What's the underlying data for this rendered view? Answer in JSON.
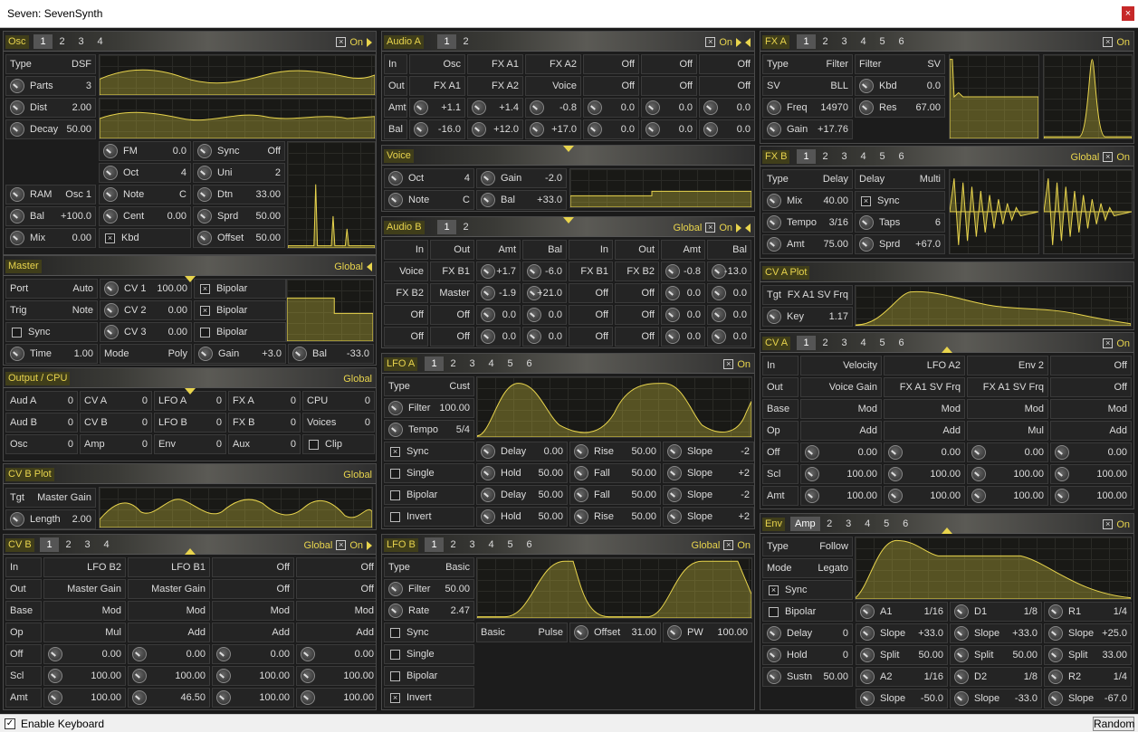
{
  "window": {
    "title": "Seven: SevenSynth",
    "close": "×"
  },
  "colors": {
    "accent": "#e8d44d",
    "bg": "#1c1c1c"
  },
  "statusbar": {
    "enable_keyboard": "Enable Keyboard",
    "checked": "✓",
    "random": "Random"
  },
  "h": {
    "osc": {
      "title": "Osc",
      "tabs": [
        "1",
        "2",
        "3",
        "4"
      ],
      "on": "On"
    },
    "master": {
      "title": "Master",
      "right": "Global"
    },
    "output": {
      "title": "Output / CPU",
      "right": "Global"
    },
    "cvbplot": {
      "title": "CV B Plot",
      "right": "Global"
    },
    "cvb": {
      "title": "CV B",
      "tabs": [
        "1",
        "2",
        "3",
        "4"
      ],
      "right": "Global",
      "on": "On"
    },
    "audioa": {
      "title": "Audio A",
      "tabs": [
        "1",
        "2"
      ],
      "on": "On"
    },
    "voice": {
      "title": "Voice"
    },
    "audiob": {
      "title": "Audio B",
      "tabs": [
        "1",
        "2"
      ],
      "right": "Global",
      "on": "On"
    },
    "lfoa": {
      "title": "LFO A",
      "tabs": [
        "1",
        "2",
        "3",
        "4",
        "5",
        "6"
      ],
      "on": "On"
    },
    "lfob": {
      "title": "LFO B",
      "tabs": [
        "1",
        "2",
        "3",
        "4",
        "5",
        "6"
      ],
      "right": "Global",
      "on": "On"
    },
    "fxa": {
      "title": "FX A",
      "tabs": [
        "1",
        "2",
        "3",
        "4",
        "5",
        "6"
      ],
      "on": "On"
    },
    "fxb": {
      "title": "FX B",
      "tabs": [
        "1",
        "2",
        "3",
        "4",
        "5",
        "6"
      ],
      "right": "Global",
      "on": "On"
    },
    "cvaplot": {
      "title": "CV A Plot"
    },
    "cva": {
      "title": "CV A",
      "tabs": [
        "1",
        "2",
        "3",
        "4",
        "5",
        "6"
      ],
      "on": "On"
    },
    "env": {
      "title": "Env",
      "tabs": [
        "Amp",
        "2",
        "3",
        "4",
        "5",
        "6"
      ],
      "on": "On"
    }
  },
  "cells": {
    "osc": [
      {
        "l": "Type",
        "v": "DSF"
      },
      {
        "l": "Parts",
        "v": "3",
        "k": 1
      },
      {
        "l": "Dist",
        "v": "2.00",
        "k": 1
      },
      {
        "l": "Decay",
        "v": "50.00",
        "k": 1
      },
      {
        "l": "FM",
        "v": "0.0",
        "k": 1
      },
      {
        "l": "Sync",
        "v": "Off",
        "k": 1
      },
      {
        "l": "Oct",
        "v": "4",
        "k": 1
      },
      {
        "l": "Uni",
        "v": "2",
        "k": 1
      },
      {
        "l": "RAM",
        "v": "Osc 1",
        "k": 1
      },
      {
        "l": "Note",
        "v": "C",
        "k": 1
      },
      {
        "l": "Dtn",
        "v": "33.00",
        "k": 1
      },
      {
        "l": "Bal",
        "v": "+100.0",
        "k": 1
      },
      {
        "l": "Cent",
        "v": "0.00",
        "k": 1
      },
      {
        "l": "Sprd",
        "v": "50.00",
        "k": 1
      },
      {
        "l": "Mix",
        "v": "0.00",
        "k": 1
      },
      {
        "l": "Kbd",
        "v": "",
        "c": "x"
      },
      {
        "l": "Offset",
        "v": "50.00",
        "k": 1
      }
    ],
    "master": [
      {
        "l": "Port",
        "v": "Auto"
      },
      {
        "l": "CV 1",
        "v": "100.00",
        "k": 1
      },
      {
        "l": "Bipolar",
        "v": "",
        "c": "x"
      },
      {
        "l": "Trig",
        "v": "Note"
      },
      {
        "l": "CV 2",
        "v": "0.00",
        "k": 1
      },
      {
        "l": "Bipolar",
        "v": "",
        "c": "x"
      },
      {
        "l": "Sync",
        "v": "",
        "c": "o"
      },
      {
        "l": "CV 3",
        "v": "0.00",
        "k": 1
      },
      {
        "l": "Bipolar",
        "v": "",
        "c": "o"
      },
      {
        "l": "Time",
        "v": "1.00",
        "k": 1
      },
      {
        "l": "Mode",
        "v": "Poly"
      },
      {
        "l": "Gain",
        "v": "+3.0",
        "k": 1
      },
      {
        "l": "Bal",
        "v": "-33.0",
        "k": 1
      }
    ],
    "output": [
      {
        "l": "Aud A",
        "v": "0"
      },
      {
        "l": "CV A",
        "v": "0"
      },
      {
        "l": "LFO A",
        "v": "0"
      },
      {
        "l": "FX A",
        "v": "0"
      },
      {
        "l": "CPU",
        "v": "0"
      },
      {
        "l": "Aud B",
        "v": "0"
      },
      {
        "l": "CV B",
        "v": "0"
      },
      {
        "l": "LFO B",
        "v": "0"
      },
      {
        "l": "FX B",
        "v": "0"
      },
      {
        "l": "Voices",
        "v": "0"
      },
      {
        "l": "Osc",
        "v": "0"
      },
      {
        "l": "Amp",
        "v": "0"
      },
      {
        "l": "Env",
        "v": "0"
      },
      {
        "l": "Aux",
        "v": "0"
      },
      {
        "l": "Clip",
        "v": "",
        "c": "r"
      }
    ],
    "cvbplot": [
      {
        "l": "Tgt",
        "v": "Master Gain"
      },
      {
        "l": "Length",
        "v": "2.00",
        "k": 1
      }
    ],
    "cvb": [
      {
        "l": "In",
        "v": ""
      },
      {
        "l": "",
        "v": "LFO B2"
      },
      {
        "l": "",
        "v": "LFO B1"
      },
      {
        "l": "",
        "v": "Off"
      },
      {
        "l": "",
        "v": "Off"
      },
      {
        "l": "Out",
        "v": ""
      },
      {
        "l": "",
        "v": "Master Gain"
      },
      {
        "l": "",
        "v": "Master Gain"
      },
      {
        "l": "",
        "v": "Off"
      },
      {
        "l": "",
        "v": "Off"
      },
      {
        "l": "Base",
        "v": ""
      },
      {
        "l": "",
        "v": "Mod"
      },
      {
        "l": "",
        "v": "Mod"
      },
      {
        "l": "",
        "v": "Mod"
      },
      {
        "l": "",
        "v": "Mod"
      },
      {
        "l": "Op",
        "v": ""
      },
      {
        "l": "",
        "v": "Mul"
      },
      {
        "l": "",
        "v": "Add"
      },
      {
        "l": "",
        "v": "Add"
      },
      {
        "l": "",
        "v": "Add"
      },
      {
        "l": "Off",
        "v": ""
      },
      {
        "l": "",
        "v": "0.00",
        "k": 1
      },
      {
        "l": "",
        "v": "0.00",
        "k": 1
      },
      {
        "l": "",
        "v": "0.00",
        "k": 1
      },
      {
        "l": "",
        "v": "0.00",
        "k": 1
      },
      {
        "l": "Scl",
        "v": ""
      },
      {
        "l": "",
        "v": "100.00",
        "k": 1
      },
      {
        "l": "",
        "v": "100.00",
        "k": 1
      },
      {
        "l": "",
        "v": "100.00",
        "k": 1
      },
      {
        "l": "",
        "v": "100.00",
        "k": 1
      },
      {
        "l": "Amt",
        "v": ""
      },
      {
        "l": "",
        "v": "100.00",
        "k": 1
      },
      {
        "l": "",
        "v": "46.50",
        "k": 1
      },
      {
        "l": "",
        "v": "100.00",
        "k": 1
      },
      {
        "l": "",
        "v": "100.00",
        "k": 1
      }
    ],
    "audioa": [
      {
        "l": "In",
        "v": ""
      },
      {
        "l": "",
        "v": "Osc"
      },
      {
        "l": "",
        "v": "FX A1"
      },
      {
        "l": "",
        "v": "FX A2"
      },
      {
        "l": "",
        "v": "Off"
      },
      {
        "l": "",
        "v": "Off"
      },
      {
        "l": "",
        "v": "Off"
      },
      {
        "l": "Out",
        "v": ""
      },
      {
        "l": "",
        "v": "FX A1"
      },
      {
        "l": "",
        "v": "FX A2"
      },
      {
        "l": "",
        "v": "Voice"
      },
      {
        "l": "",
        "v": "Off"
      },
      {
        "l": "",
        "v": "Off"
      },
      {
        "l": "",
        "v": "Off"
      },
      {
        "l": "Amt",
        "v": ""
      },
      {
        "l": "",
        "v": "+1.1",
        "k": 1
      },
      {
        "l": "",
        "v": "+1.4",
        "k": 1
      },
      {
        "l": "",
        "v": "-0.8",
        "k": 1
      },
      {
        "l": "",
        "v": "0.0",
        "k": 1
      },
      {
        "l": "",
        "v": "0.0",
        "k": 1
      },
      {
        "l": "",
        "v": "0.0",
        "k": 1
      },
      {
        "l": "Bal",
        "v": ""
      },
      {
        "l": "",
        "v": "-16.0",
        "k": 1
      },
      {
        "l": "",
        "v": "+12.0",
        "k": 1
      },
      {
        "l": "",
        "v": "+17.0",
        "k": 1
      },
      {
        "l": "",
        "v": "0.0",
        "k": 1
      },
      {
        "l": "",
        "v": "0.0",
        "k": 1
      },
      {
        "l": "",
        "v": "0.0",
        "k": 1
      }
    ],
    "voice": [
      {
        "l": "Oct",
        "v": "4",
        "k": 1
      },
      {
        "l": "Gain",
        "v": "-2.0",
        "k": 1
      },
      {
        "l": "Note",
        "v": "C",
        "k": 1
      },
      {
        "l": "Bal",
        "v": "+33.0",
        "k": 1
      }
    ],
    "audiobh": [
      {
        "l": "",
        "v": "In"
      },
      {
        "l": "",
        "v": "Out"
      },
      {
        "l": "",
        "v": "Amt"
      },
      {
        "l": "",
        "v": "Bal"
      },
      {
        "l": "",
        "v": "In"
      },
      {
        "l": "",
        "v": "Out"
      },
      {
        "l": "",
        "v": "Amt"
      },
      {
        "l": "",
        "v": "Bal"
      }
    ],
    "audiob": [
      {
        "l": "",
        "v": "Voice"
      },
      {
        "l": "",
        "v": "FX B1"
      },
      {
        "l": "",
        "v": "+1.7",
        "k": 1
      },
      {
        "l": "",
        "v": "-6.0",
        "k": 1
      },
      {
        "l": "",
        "v": "FX B1"
      },
      {
        "l": "",
        "v": "FX B2"
      },
      {
        "l": "",
        "v": "-0.8",
        "k": 1
      },
      {
        "l": "",
        "v": "-13.0",
        "k": 1
      },
      {
        "l": "",
        "v": "FX B2"
      },
      {
        "l": "",
        "v": "Master"
      },
      {
        "l": "",
        "v": "-1.9",
        "k": 1
      },
      {
        "l": "",
        "v": "+21.0",
        "k": 1
      },
      {
        "l": "",
        "v": "Off"
      },
      {
        "l": "",
        "v": "Off"
      },
      {
        "l": "",
        "v": "0.0",
        "k": 1
      },
      {
        "l": "",
        "v": "0.0",
        "k": 1
      },
      {
        "l": "",
        "v": "Off"
      },
      {
        "l": "",
        "v": "Off"
      },
      {
        "l": "",
        "v": "0.0",
        "k": 1
      },
      {
        "l": "",
        "v": "0.0",
        "k": 1
      },
      {
        "l": "",
        "v": "Off"
      },
      {
        "l": "",
        "v": "Off"
      },
      {
        "l": "",
        "v": "0.0",
        "k": 1
      },
      {
        "l": "",
        "v": "0.0",
        "k": 1
      },
      {
        "l": "",
        "v": "Off"
      },
      {
        "l": "",
        "v": "Off"
      },
      {
        "l": "",
        "v": "0.0",
        "k": 1
      },
      {
        "l": "",
        "v": "0.0",
        "k": 1
      },
      {
        "l": "",
        "v": "Off"
      },
      {
        "l": "",
        "v": "Off"
      },
      {
        "l": "",
        "v": "0.0",
        "k": 1
      },
      {
        "l": "",
        "v": "0.0",
        "k": 1
      }
    ],
    "lfoa": [
      {
        "l": "Type",
        "v": "Cust"
      },
      {
        "l": "Filter",
        "v": "100.00",
        "k": 1
      },
      {
        "l": "Tempo",
        "v": "5/4",
        "k": 1
      },
      {
        "l": "Sync",
        "v": "",
        "c": "x"
      },
      {
        "l": "Delay",
        "v": "0.00",
        "k": 1
      },
      {
        "l": "Rise",
        "v": "50.00",
        "k": 1
      },
      {
        "l": "Slope",
        "v": "-2",
        "k": 1
      },
      {
        "l": "Single",
        "v": "",
        "c": "o"
      },
      {
        "l": "Hold",
        "v": "50.00",
        "k": 1
      },
      {
        "l": "Fall",
        "v": "50.00",
        "k": 1
      },
      {
        "l": "Slope",
        "v": "+2",
        "k": 1
      },
      {
        "l": "Bipolar",
        "v": "",
        "c": "o"
      },
      {
        "l": "Delay",
        "v": "50.00",
        "k": 1
      },
      {
        "l": "Fall",
        "v": "50.00",
        "k": 1
      },
      {
        "l": "Slope",
        "v": "-2",
        "k": 1
      },
      {
        "l": "Invert",
        "v": "",
        "c": "o"
      },
      {
        "l": "Hold",
        "v": "50.00",
        "k": 1
      },
      {
        "l": "Rise",
        "v": "50.00",
        "k": 1
      },
      {
        "l": "Slope",
        "v": "+2",
        "k": 1
      }
    ],
    "lfob": [
      {
        "l": "Type",
        "v": "Basic"
      },
      {
        "l": "Filter",
        "v": "50.00",
        "k": 1
      },
      {
        "l": "Rate",
        "v": "2.47",
        "k": 1
      },
      {
        "l": "Sync",
        "v": "",
        "c": "o"
      },
      {
        "l": "Basic",
        "v": "Pulse"
      },
      {
        "l": "Offset",
        "v": "31.00",
        "k": 1
      },
      {
        "l": "PW",
        "v": "100.00",
        "k": 1
      },
      {
        "l": "Single",
        "v": "",
        "c": "o"
      },
      {
        "l": "Bipolar",
        "v": "",
        "c": "o"
      },
      {
        "l": "Invert",
        "v": "",
        "c": "x"
      }
    ],
    "fxa": [
      {
        "l": "Type",
        "v": "Filter"
      },
      {
        "l": "Filter",
        "v": "SV"
      },
      {
        "l": "SV",
        "v": "BLL"
      },
      {
        "l": "Kbd",
        "v": "0.0",
        "k": 1
      },
      {
        "l": "Freq",
        "v": "14970",
        "k": 1
      },
      {
        "l": "Res",
        "v": "67.00",
        "k": 1
      },
      {
        "l": "Gain",
        "v": "+17.76",
        "k": 1
      }
    ],
    "fxb": [
      {
        "l": "Type",
        "v": "Delay"
      },
      {
        "l": "Delay",
        "v": "Multi"
      },
      {
        "l": "Mix",
        "v": "40.00",
        "k": 1
      },
      {
        "l": "Sync",
        "v": "",
        "c": "x"
      },
      {
        "l": "Tempo",
        "v": "3/16",
        "k": 1
      },
      {
        "l": "Taps",
        "v": "6",
        "k": 1
      },
      {
        "l": "Amt",
        "v": "75.00",
        "k": 1
      },
      {
        "l": "Sprd",
        "v": "+67.0",
        "k": 1
      }
    ],
    "cvaplot": [
      {
        "l": "Tgt",
        "v": "FX A1 SV Frq"
      },
      {
        "l": "Key",
        "v": "1.17",
        "k": 1
      }
    ],
    "cva": [
      {
        "l": "In",
        "v": ""
      },
      {
        "l": "",
        "v": "Velocity"
      },
      {
        "l": "",
        "v": "LFO A2"
      },
      {
        "l": "",
        "v": "Env 2"
      },
      {
        "l": "",
        "v": "Off"
      },
      {
        "l": "Out",
        "v": ""
      },
      {
        "l": "",
        "v": "Voice Gain"
      },
      {
        "l": "",
        "v": "FX A1 SV Frq"
      },
      {
        "l": "",
        "v": "FX A1 SV Frq"
      },
      {
        "l": "",
        "v": "Off"
      },
      {
        "l": "Base",
        "v": ""
      },
      {
        "l": "",
        "v": "Mod"
      },
      {
        "l": "",
        "v": "Mod"
      },
      {
        "l": "",
        "v": "Mod"
      },
      {
        "l": "",
        "v": "Mod"
      },
      {
        "l": "Op",
        "v": ""
      },
      {
        "l": "",
        "v": "Add"
      },
      {
        "l": "",
        "v": "Add"
      },
      {
        "l": "",
        "v": "Mul"
      },
      {
        "l": "",
        "v": "Add"
      },
      {
        "l": "Off",
        "v": ""
      },
      {
        "l": "",
        "v": "0.00",
        "k": 1
      },
      {
        "l": "",
        "v": "0.00",
        "k": 1
      },
      {
        "l": "",
        "v": "0.00",
        "k": 1
      },
      {
        "l": "",
        "v": "0.00",
        "k": 1
      },
      {
        "l": "Scl",
        "v": ""
      },
      {
        "l": "",
        "v": "100.00",
        "k": 1
      },
      {
        "l": "",
        "v": "100.00",
        "k": 1
      },
      {
        "l": "",
        "v": "100.00",
        "k": 1
      },
      {
        "l": "",
        "v": "100.00",
        "k": 1
      },
      {
        "l": "Amt",
        "v": ""
      },
      {
        "l": "",
        "v": "100.00",
        "k": 1
      },
      {
        "l": "",
        "v": "100.00",
        "k": 1
      },
      {
        "l": "",
        "v": "100.00",
        "k": 1
      },
      {
        "l": "",
        "v": "100.00",
        "k": 1
      }
    ],
    "env": [
      {
        "l": "Type",
        "v": "Follow"
      },
      {
        "l": "Mode",
        "v": "Legato"
      },
      {
        "l": "Sync",
        "v": "",
        "c": "x"
      },
      {
        "l": "Bipolar",
        "v": "",
        "c": "o"
      },
      {
        "l": "Invert",
        "v": "",
        "c": "o"
      },
      {
        "l": "A1",
        "v": "1/16",
        "k": 1
      },
      {
        "l": "D1",
        "v": "1/8",
        "k": 1
      },
      {
        "l": "R1",
        "v": "1/4",
        "k": 1
      },
      {
        "l": "Delay",
        "v": "0",
        "k": 1
      },
      {
        "l": "Slope",
        "v": "+33.0",
        "k": 1
      },
      {
        "l": "Slope",
        "v": "+33.0",
        "k": 1
      },
      {
        "l": "Slope",
        "v": "+25.0",
        "k": 1
      },
      {
        "l": "Hold",
        "v": "0",
        "k": 1
      },
      {
        "l": "Split",
        "v": "50.00",
        "k": 1
      },
      {
        "l": "Split",
        "v": "50.00",
        "k": 1
      },
      {
        "l": "Split",
        "v": "33.00",
        "k": 1
      },
      {
        "l": "Sustn",
        "v": "50.00",
        "k": 1
      },
      {
        "l": "A2",
        "v": "1/16",
        "k": 1
      },
      {
        "l": "D2",
        "v": "1/8",
        "k": 1
      },
      {
        "l": "R2",
        "v": "1/4",
        "k": 1
      },
      {
        "l": "Slope",
        "v": "-50.0",
        "k": 1
      },
      {
        "l": "Slope",
        "v": "-33.0",
        "k": 1
      },
      {
        "l": "Slope",
        "v": "-67.0",
        "k": 1
      }
    ]
  }
}
